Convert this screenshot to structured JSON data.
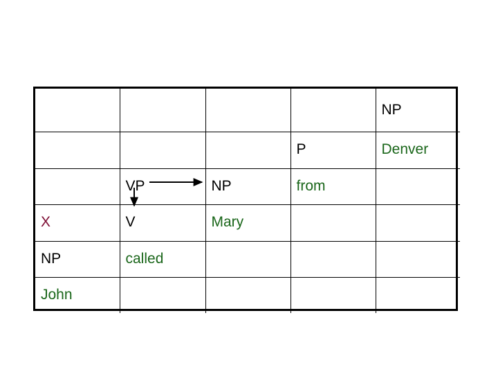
{
  "figure": {
    "kind": "cky-parse-chart",
    "description": "Parse chart table with nonterminal and word entries"
  },
  "colors": {
    "black": "#000000",
    "green": "#1a661a",
    "maroon": "#7d0c33",
    "grid": "#000000",
    "background": "#ffffff"
  },
  "chart_data": {
    "type": "table",
    "title": "",
    "columns": 5,
    "rows": 6,
    "column_headers": [
      "",
      "",
      "",
      "",
      ""
    ],
    "cells": [
      [
        {
          "text": "",
          "color": "#000000"
        },
        {
          "text": "",
          "color": "#000000"
        },
        {
          "text": "",
          "color": "#000000"
        },
        {
          "text": "",
          "color": "#000000"
        },
        {
          "text": "NP",
          "color": "#000000"
        }
      ],
      [
        {
          "text": "",
          "color": "#000000"
        },
        {
          "text": "",
          "color": "#000000"
        },
        {
          "text": "",
          "color": "#000000"
        },
        {
          "text": "P",
          "color": "#000000"
        },
        {
          "text": "Denver",
          "color": "#1a661a"
        }
      ],
      [
        {
          "text": "",
          "color": "#000000"
        },
        {
          "text": "VP",
          "color": "#000000"
        },
        {
          "text": "NP",
          "color": "#000000"
        },
        {
          "text": "from",
          "color": "#1a661a"
        },
        {
          "text": "",
          "color": "#000000"
        }
      ],
      [
        {
          "text": "X",
          "color": "#7d0c33"
        },
        {
          "text": "V",
          "color": "#000000"
        },
        {
          "text": "Mary",
          "color": "#1a661a"
        },
        {
          "text": "",
          "color": "#000000"
        },
        {
          "text": "",
          "color": "#000000"
        }
      ],
      [
        {
          "text": "NP",
          "color": "#000000"
        },
        {
          "text": "called",
          "color": "#1a661a"
        },
        {
          "text": "",
          "color": "#000000"
        },
        {
          "text": "",
          "color": "#000000"
        },
        {
          "text": "",
          "color": "#000000"
        }
      ],
      [
        {
          "text": "John",
          "color": "#1a661a"
        },
        {
          "text": "",
          "color": "#000000"
        },
        {
          "text": "",
          "color": "#000000"
        },
        {
          "text": "",
          "color": "#000000"
        },
        {
          "text": "",
          "color": "#000000"
        }
      ]
    ],
    "annotations": [
      {
        "name": "vp-to-np-arrow",
        "type": "arrow",
        "direction": "right",
        "from": "VP",
        "to": "NP",
        "color": "#000000"
      },
      {
        "name": "vp-to-v-arrow",
        "type": "arrow",
        "direction": "down",
        "from": "VP",
        "to": "V",
        "color": "#000000"
      }
    ]
  }
}
